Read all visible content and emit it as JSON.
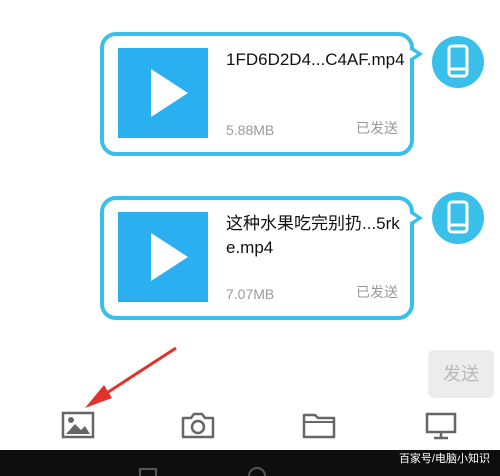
{
  "messages": [
    {
      "filename": "1FD6D2D4...C4AF.mp4",
      "size": "5.88MB",
      "status": "已发送"
    },
    {
      "filename": "这种水果吃完别扔...5rke.mp4",
      "size": "7.07MB",
      "status": "已发送"
    }
  ],
  "send_button": {
    "label": "发送"
  },
  "toolbar": [
    "image-icon",
    "camera-icon",
    "folder-icon",
    "screen-icon"
  ],
  "watermark": "百家号/电脑小知识",
  "colors": {
    "accent": "#38c0ea",
    "thumbnail": "#2aaff0",
    "arrow": "#e0332b",
    "navbar": "#0e0e0e"
  }
}
